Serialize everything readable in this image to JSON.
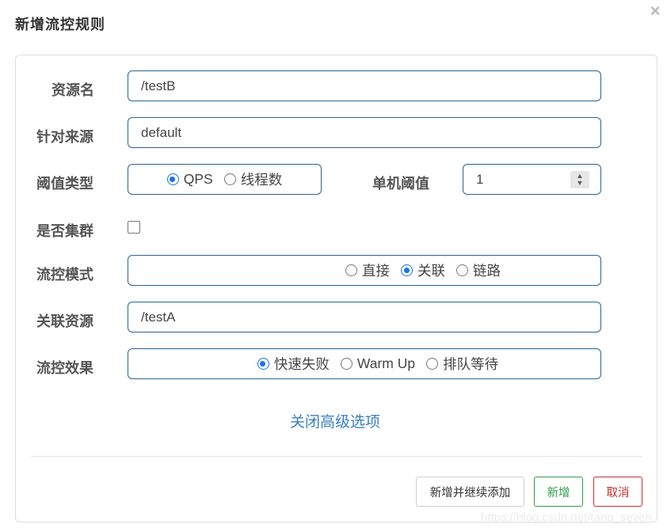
{
  "dialog": {
    "title": "新增流控规则",
    "close_icon": "×"
  },
  "form": {
    "resource_name": {
      "label": "资源名",
      "value": "/testB"
    },
    "limit_app": {
      "label": "针对来源",
      "value": "default"
    },
    "threshold_type": {
      "label": "阈值类型",
      "options": [
        "QPS",
        "线程数"
      ],
      "selected": "QPS"
    },
    "single_threshold": {
      "label": "单机阈值",
      "value": "1"
    },
    "cluster": {
      "label": "是否集群",
      "checked": false
    },
    "flow_mode": {
      "label": "流控模式",
      "options": [
        "直接",
        "关联",
        "链路"
      ],
      "selected": "关联"
    },
    "ref_resource": {
      "label": "关联资源",
      "value": "/testA"
    },
    "control_behavior": {
      "label": "流控效果",
      "options": [
        "快速失败",
        "Warm Up",
        "排队等待"
      ],
      "selected": "快速失败"
    },
    "advanced_link": "关闭高级选项"
  },
  "footer": {
    "add_continue_label": "新增并继续添加",
    "add_label": "新增",
    "cancel_label": "取消"
  },
  "watermark": "https://blog.csdn.net/tang_seven",
  "colors": {
    "accent": "#1a73e8",
    "field_border": "#2a6496",
    "link": "#3a7fbf",
    "success": "#2e9e4a",
    "danger": "#c9302c"
  }
}
